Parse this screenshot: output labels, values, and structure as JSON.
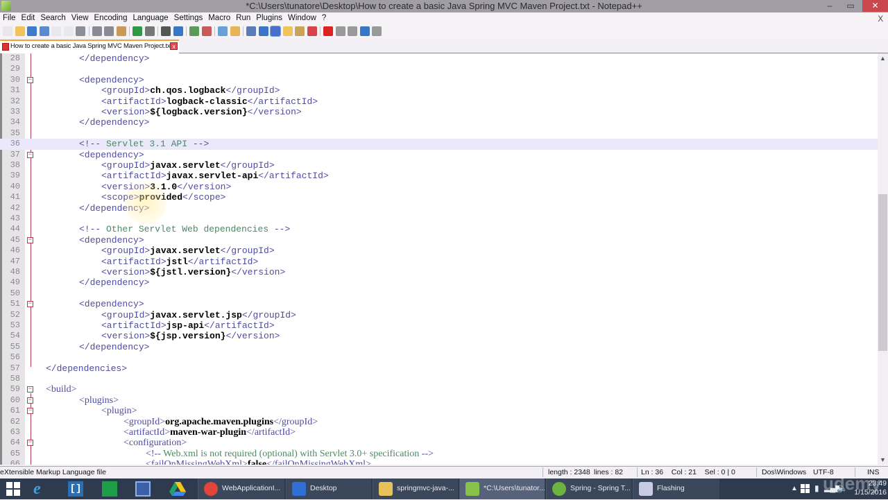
{
  "window": {
    "title": "*C:\\Users\\tunatore\\Desktop\\How to create a basic Java Spring MVC Maven Project.txt - Notepad++",
    "minimize": "–",
    "maximize": "▭",
    "close": "✕"
  },
  "menu": {
    "items": [
      "File",
      "Edit",
      "Search",
      "View",
      "Encoding",
      "Language",
      "Settings",
      "Macro",
      "Run",
      "Plugins",
      "Window",
      "?"
    ],
    "close_doc": "X"
  },
  "toolbar": {
    "icons": [
      "new-file-icon",
      "open-file-icon",
      "save-icon",
      "save-all-icon",
      "close-icon",
      "close-all-icon",
      "print-icon",
      "cut-icon",
      "copy-icon",
      "paste-icon",
      "undo-icon",
      "redo-icon",
      "find-icon",
      "replace-icon",
      "zoom-in-icon",
      "zoom-out-icon",
      "sync-vertical-icon",
      "sync-horizontal-icon",
      "word-wrap-icon",
      "show-all-chars-icon",
      "indent-guide-icon",
      "doc-map-icon",
      "function-list-icon",
      "folder-workspace-icon",
      "record-macro-icon",
      "stop-macro-icon",
      "play-macro-icon",
      "run-macro-multiple-icon",
      "save-macro-icon"
    ]
  },
  "tab": {
    "label": "How to create a basic Java Spring MVC Maven Project.txt",
    "close": "x"
  },
  "editor": {
    "current_line": 36,
    "lines": [
      {
        "n": 28,
        "fold": "",
        "indent": 2,
        "parts": [
          [
            "tag",
            "</dependency>"
          ]
        ]
      },
      {
        "n": 29,
        "fold": "",
        "indent": 0,
        "parts": []
      },
      {
        "n": 30,
        "fold": "box",
        "indent": 2,
        "parts": [
          [
            "tag",
            "<dependency>"
          ]
        ]
      },
      {
        "n": 31,
        "fold": "",
        "indent": 3,
        "parts": [
          [
            "tag",
            "<groupId>"
          ],
          [
            "val",
            "ch.qos.logback"
          ],
          [
            "tag",
            "</groupId>"
          ]
        ]
      },
      {
        "n": 32,
        "fold": "",
        "indent": 3,
        "parts": [
          [
            "tag",
            "<artifactId>"
          ],
          [
            "val",
            "logback-classic"
          ],
          [
            "tag",
            "</artifactId>"
          ]
        ]
      },
      {
        "n": 33,
        "fold": "",
        "indent": 3,
        "parts": [
          [
            "tag",
            "<version>"
          ],
          [
            "val",
            "${logback.version}"
          ],
          [
            "tag",
            "</version>"
          ]
        ]
      },
      {
        "n": 34,
        "fold": "",
        "indent": 2,
        "parts": [
          [
            "tag",
            "</dependency>"
          ]
        ]
      },
      {
        "n": 35,
        "fold": "",
        "indent": 0,
        "parts": []
      },
      {
        "n": 36,
        "fold": "",
        "indent": 2,
        "parts": [
          [
            "tag",
            "<!-- "
          ],
          [
            "cmt",
            "Servlet 3.1 API"
          ],
          [
            "tag",
            " -->"
          ]
        ]
      },
      {
        "n": 37,
        "fold": "box",
        "indent": 2,
        "parts": [
          [
            "tag",
            "<dependency>"
          ]
        ]
      },
      {
        "n": 38,
        "fold": "",
        "indent": 3,
        "parts": [
          [
            "tag",
            "<groupId>"
          ],
          [
            "val",
            "javax.servlet"
          ],
          [
            "tag",
            "</groupId>"
          ]
        ]
      },
      {
        "n": 39,
        "fold": "",
        "indent": 3,
        "parts": [
          [
            "tag",
            "<artifactId>"
          ],
          [
            "val",
            "javax.servlet-api"
          ],
          [
            "tag",
            "</artifactId>"
          ]
        ]
      },
      {
        "n": 40,
        "fold": "",
        "indent": 3,
        "parts": [
          [
            "tag",
            "<version>"
          ],
          [
            "val",
            "3.1.0"
          ],
          [
            "tag",
            "</version>"
          ]
        ]
      },
      {
        "n": 41,
        "fold": "",
        "indent": 3,
        "parts": [
          [
            "tag",
            "<scope>"
          ],
          [
            "val",
            "provided"
          ],
          [
            "tag",
            "</scope>"
          ]
        ]
      },
      {
        "n": 42,
        "fold": "",
        "indent": 2,
        "parts": [
          [
            "tag",
            "</dependency>"
          ]
        ]
      },
      {
        "n": 43,
        "fold": "",
        "indent": 0,
        "parts": []
      },
      {
        "n": 44,
        "fold": "",
        "indent": 2,
        "parts": [
          [
            "tag",
            "<!-- "
          ],
          [
            "cmt",
            "Other Servlet Web dependencies"
          ],
          [
            "tag",
            " -->"
          ]
        ]
      },
      {
        "n": 45,
        "fold": "box",
        "indent": 2,
        "parts": [
          [
            "tag",
            "<dependency>"
          ]
        ]
      },
      {
        "n": 46,
        "fold": "",
        "indent": 3,
        "parts": [
          [
            "tag",
            "<groupId>"
          ],
          [
            "val",
            "javax.servlet"
          ],
          [
            "tag",
            "</groupId>"
          ]
        ]
      },
      {
        "n": 47,
        "fold": "",
        "indent": 3,
        "parts": [
          [
            "tag",
            "<artifactId>"
          ],
          [
            "val",
            "jstl"
          ],
          [
            "tag",
            "</artifactId>"
          ]
        ]
      },
      {
        "n": 48,
        "fold": "",
        "indent": 3,
        "parts": [
          [
            "tag",
            "<version>"
          ],
          [
            "val",
            "${jstl.version}"
          ],
          [
            "tag",
            "</version>"
          ]
        ]
      },
      {
        "n": 49,
        "fold": "",
        "indent": 2,
        "parts": [
          [
            "tag",
            "</dependency>"
          ]
        ]
      },
      {
        "n": 50,
        "fold": "",
        "indent": 0,
        "parts": []
      },
      {
        "n": 51,
        "fold": "box",
        "indent": 2,
        "parts": [
          [
            "tag",
            "<dependency>"
          ]
        ]
      },
      {
        "n": 52,
        "fold": "",
        "indent": 3,
        "parts": [
          [
            "tag",
            "<groupId>"
          ],
          [
            "val",
            "javax.servlet.jsp"
          ],
          [
            "tag",
            "</groupId>"
          ]
        ]
      },
      {
        "n": 53,
        "fold": "",
        "indent": 3,
        "parts": [
          [
            "tag",
            "<artifactId>"
          ],
          [
            "val",
            "jsp-api"
          ],
          [
            "tag",
            "</artifactId>"
          ]
        ]
      },
      {
        "n": 54,
        "fold": "",
        "indent": 3,
        "parts": [
          [
            "tag",
            "<version>"
          ],
          [
            "val",
            "${jsp.version}"
          ],
          [
            "tag",
            "</version>"
          ]
        ]
      },
      {
        "n": 55,
        "fold": "",
        "indent": 2,
        "parts": [
          [
            "tag",
            "</dependency>"
          ]
        ]
      },
      {
        "n": 56,
        "fold": "",
        "indent": 0,
        "parts": []
      },
      {
        "n": 57,
        "fold": "end",
        "indent": 1,
        "parts": [
          [
            "tag",
            "</dependencies>"
          ]
        ]
      },
      {
        "n": 58,
        "fold": "",
        "indent": 0,
        "parts": []
      },
      {
        "n": 59,
        "fold": "box",
        "indent": 1,
        "serif": true,
        "parts": [
          [
            "tag",
            "<build>"
          ]
        ]
      },
      {
        "n": 60,
        "fold": "box",
        "indent": 2,
        "serif": true,
        "parts": [
          [
            "tag",
            "<plugins>"
          ]
        ]
      },
      {
        "n": 61,
        "fold": "box",
        "indent": 3,
        "serif": true,
        "parts": [
          [
            "tag",
            "<plugin>"
          ]
        ]
      },
      {
        "n": 62,
        "fold": "",
        "indent": 4,
        "serif": true,
        "parts": [
          [
            "tag",
            "<groupId>"
          ],
          [
            "val",
            "org.apache.maven.plugins"
          ],
          [
            "tag",
            "</groupId>"
          ]
        ]
      },
      {
        "n": 63,
        "fold": "",
        "indent": 4,
        "serif": true,
        "parts": [
          [
            "tag",
            "<artifactId>"
          ],
          [
            "val",
            "maven-war-plugin"
          ],
          [
            "tag",
            "</artifactId>"
          ]
        ]
      },
      {
        "n": 64,
        "fold": "box",
        "indent": 4,
        "serif": true,
        "parts": [
          [
            "tag",
            "<configuration>"
          ]
        ]
      },
      {
        "n": 65,
        "fold": "",
        "indent": 5,
        "serif": true,
        "parts": [
          [
            "tag",
            "<!-- "
          ],
          [
            "cmt",
            "Web.xml is not required (optional) with Servlet 3.0+ specification"
          ],
          [
            "tag",
            " -->"
          ]
        ]
      },
      {
        "n": 66,
        "fold": "",
        "indent": 5,
        "serif": true,
        "parts": [
          [
            "tag",
            "<failOnMissingWebXml>"
          ],
          [
            "val",
            "false"
          ],
          [
            "tag",
            "</failOnMissingWebXml>"
          ]
        ]
      }
    ]
  },
  "status": {
    "file_type": "eXtensible Markup Language file",
    "length": "length : 2348",
    "lines": "lines : 82",
    "position": "Ln : 36    Col : 21    Sel : 0 | 0",
    "eol": "Dos\\Windows",
    "encoding": "UTF-8",
    "mode": "INS"
  },
  "taskbar": {
    "pinned": [
      "start-button",
      "internet-explorer",
      "brackets",
      "windows-store",
      "remote-desktop",
      "google-drive"
    ],
    "apps": [
      {
        "label": "WebApplicationI...",
        "icon": "chrome-icon",
        "color": "#e2463a"
      },
      {
        "label": "Desktop",
        "icon": "desktop-icon",
        "color": "#2f6fd6"
      },
      {
        "label": "springmvc-java-...",
        "icon": "folder-icon",
        "color": "#e8c15a"
      },
      {
        "label": "*C:\\Users\\tunator...",
        "icon": "notepadpp-icon",
        "color": "#86c24a",
        "active": true
      },
      {
        "label": "Spring - Spring T...",
        "icon": "spring-icon",
        "color": "#6db33f"
      },
      {
        "label": "Flashing",
        "icon": "window-icon",
        "color": "#c7cbe6"
      }
    ],
    "clock_time": "23:49",
    "clock_date": "1/15/2016",
    "watermark": "udemy"
  }
}
